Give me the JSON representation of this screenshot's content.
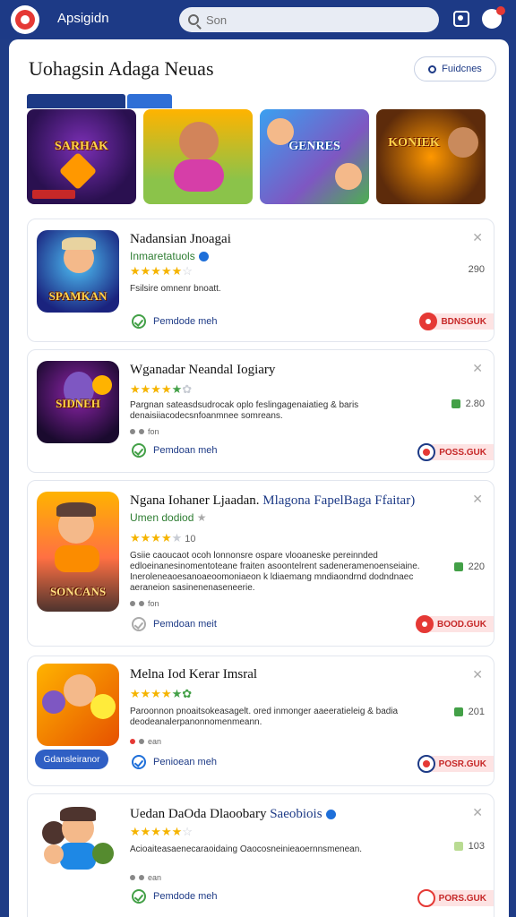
{
  "app": {
    "name": "Apsigidn"
  },
  "search": {
    "placeholder": "Son"
  },
  "page": {
    "title": "Uohagsin Adaga Neuas",
    "filter_label": "Fuidcnes"
  },
  "featured": [
    {
      "label": "",
      "art_text": "SARHAK"
    },
    {
      "label": "",
      "art_text": ""
    },
    {
      "label": "",
      "art_text": "GENRES"
    },
    {
      "label": "",
      "art_text": "KONIEK"
    }
  ],
  "featured_tags": {
    "left": "",
    "right": ""
  },
  "cards": [
    {
      "title": "Nadansian Jnoagai",
      "title_highlight": "",
      "subtitle": "Inmaretatuols",
      "verified": true,
      "rating_number": "",
      "description": "Fsilsire omnenr bnoatt.",
      "meta": "",
      "download_label": "Pemdode meh",
      "count": "290",
      "get_label": "BDNSGUK",
      "thumb_text": "SPAMKAN"
    },
    {
      "title": "Wganadar Neandal Iogiary",
      "title_highlight": "",
      "subtitle": "",
      "verified": false,
      "rating_number": "",
      "description": "Pargnan sateasdsudrocak oplo feslingagenaiatieg & baris denaisiiacodecsnfoanmnee somreans.",
      "meta": "fon",
      "download_label": "Pemdoan meh",
      "count": "2.80",
      "get_label": "POSS.GUK",
      "thumb_text": "SIDNEH"
    },
    {
      "title": "Ngana Iohaner Ljaadan.",
      "title_highlight": "Mlagona FapelBaga Ffaitar)",
      "subtitle": "Umen dodiod",
      "verified": false,
      "rating_number": "10",
      "description": "Gsiie caoucaot ocoh lonnonsre ospare vlooaneske pereinnded edloeinanesinomentoteane fraiten asoontelrent sadeneramenoenseiaine. Ineroleneaoesanoaeoomoniaeon k ldiaemang mndiaondrnd dodndnaec aeraneion sasinenenaseneerie.",
      "meta": "fon",
      "download_label": "Pemdoan meit",
      "count": "220",
      "get_label": "BOOD.GUK",
      "thumb_text": "SONCANS"
    },
    {
      "title": "Melna Iod Kerar Imsral",
      "title_highlight": "",
      "subtitle": "",
      "verified": false,
      "rating_number": "",
      "description": "Paroonnon pnoaitsokeasagelt. ored inmonger aaeeratieleig & badia deodeanalerpanonnomenmeann.",
      "meta": "ean",
      "download_label": "Penioean meh",
      "count": "201",
      "get_label": "POSR.GUK",
      "thumb_text": "",
      "install_label": "Gdansleiranor"
    },
    {
      "title": "Uedan DaOda Dlaoobary",
      "title_highlight": "Saeobiois",
      "subtitle": "",
      "verified": true,
      "rating_number": "",
      "description": "Acioaiteasaenecaraoidaing Oaocosneinieaoernnsmenean.",
      "meta": "ean",
      "download_label": "Pemdode meh",
      "count": "103",
      "get_label": "PORS.GUK",
      "thumb_text": ""
    }
  ],
  "colors": {
    "brand": "#1d3a86",
    "accent": "#e53935",
    "star": "#f5b400",
    "success": "#43a047"
  }
}
